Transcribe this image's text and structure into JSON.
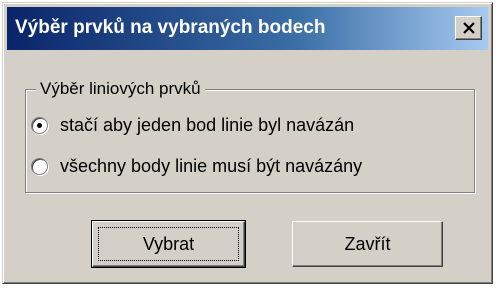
{
  "window": {
    "title": "Výběr prvků na vybraných bodech",
    "close_glyph": "close-icon"
  },
  "group": {
    "legend": "Výběr liniových prvků",
    "options": [
      {
        "label": "stačí aby jeden bod linie byl navázán",
        "selected": true
      },
      {
        "label": "všechny body linie musí být navázány",
        "selected": false
      }
    ]
  },
  "buttons": {
    "select_label": "Vybrat",
    "close_label": "Zavřít"
  },
  "colors": {
    "titlebar_start": "#0a246a",
    "titlebar_end": "#a6caf0",
    "face": "#d4d0c8"
  }
}
